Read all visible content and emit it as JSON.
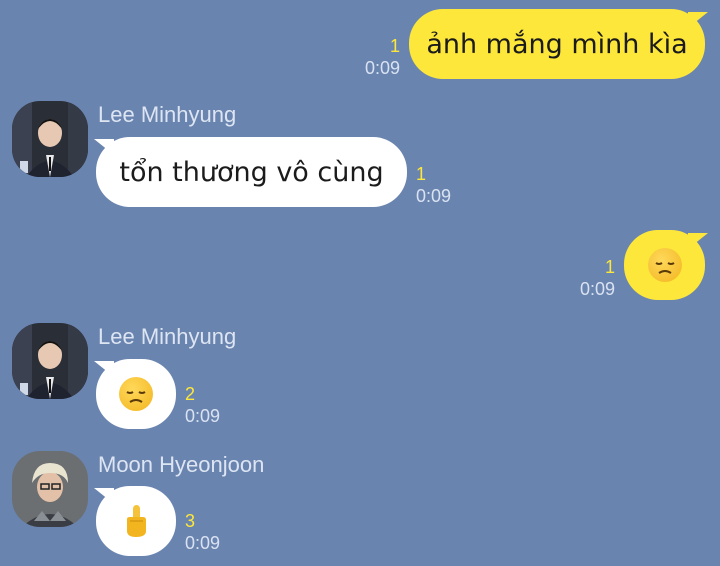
{
  "messages": [
    {
      "sender": "me",
      "text": "ảnh mắng mình kìa",
      "unread": "1",
      "time": "0:09"
    },
    {
      "sender": "Lee Minhyung",
      "text": "tổn thương vô cùng",
      "unread": "1",
      "time": "0:09"
    },
    {
      "sender": "me",
      "emoji": "disappointed-face",
      "unread": "1",
      "time": "0:09"
    },
    {
      "sender": "Lee Minhyung",
      "emoji": "disappointed-face",
      "unread": "2",
      "time": "0:09"
    },
    {
      "sender": "Moon Hyeonjoon",
      "emoji": "middle-finger",
      "unread": "3",
      "time": "0:09"
    }
  ],
  "colors": {
    "background": "#6a84b0",
    "my_bubble": "#fde73b",
    "their_bubble": "#ffffff",
    "unread_count": "#fde73b"
  }
}
